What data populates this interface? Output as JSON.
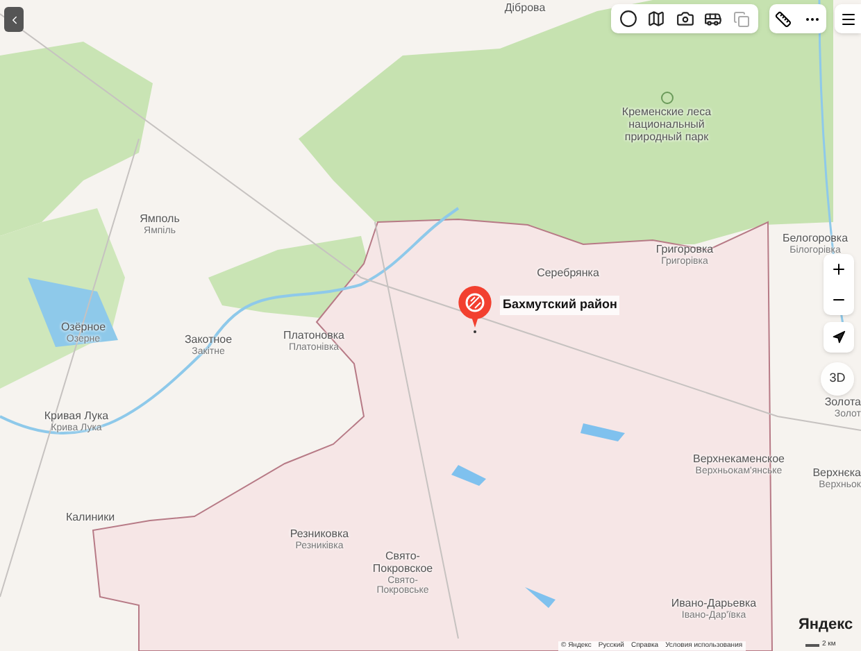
{
  "map": {
    "labels": [
      {
        "text": "Діброва"
      },
      {
        "text": "Кременские леса национальный природный парк",
        "kind": "park"
      },
      {
        "text": "Ямполь",
        "subtext": "Ямпіль"
      },
      {
        "text": "Озёрное",
        "subtext": "Озерне"
      },
      {
        "text": "Закотное",
        "subtext": "Закітне"
      },
      {
        "text": "Платоновка",
        "subtext": "Платонівка"
      },
      {
        "text": "Кривая Лука",
        "subtext": "Крива Лука"
      },
      {
        "text": "Серебрянка"
      },
      {
        "text": "Григоровка",
        "subtext": "Григорівка"
      },
      {
        "text": "Белогоровка",
        "subtext": "Білогорівка"
      },
      {
        "text": "Золота",
        "subtext": "Золот"
      },
      {
        "text": "Верхнекаменское",
        "subtext": "Верхньокам'янське"
      },
      {
        "text": "Верхнєка",
        "subtext": "Верхньок"
      },
      {
        "text": "Калиники"
      },
      {
        "text": "Резниковка",
        "subtext": "Резниківка"
      },
      {
        "text": "Свято-Покровское",
        "subtext": "Свято-Покровське"
      },
      {
        "text": "Ивано-Дарьевка",
        "subtext": "Івано-Дар'ївка"
      }
    ],
    "pin": {
      "label": "Бахмутский район"
    }
  },
  "controls": {
    "view_3d": "3D"
  },
  "logo": "Яндекс",
  "footer": {
    "links": [
      "© Яндекс",
      "Русский",
      "Справка",
      "Условия использования"
    ],
    "scale": "2 км"
  }
}
